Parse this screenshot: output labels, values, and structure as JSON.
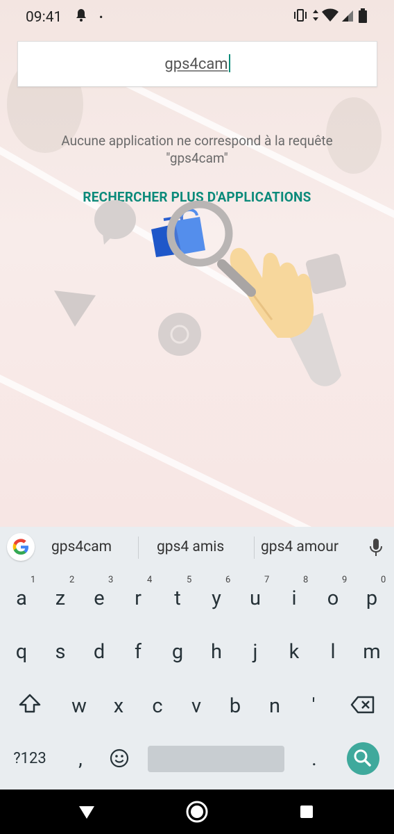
{
  "status_bar": {
    "time": "09:41",
    "icons": [
      "notification-bell-icon",
      "dot-icon",
      "vibrate-icon",
      "data-arrows-icon",
      "wifi-icon",
      "signal-icon",
      "battery-icon"
    ]
  },
  "search": {
    "query": "gps4cam"
  },
  "results": {
    "no_result_line1": "Aucune application ne correspond à la requête",
    "no_result_line2": "\"gps4cam\"",
    "more_apps_label": "RECHERCHER PLUS D'APPLICATIONS"
  },
  "suggestions": {
    "items": [
      "gps4cam",
      "gps4 amis",
      "gps4 amour"
    ]
  },
  "keyboard": {
    "row1": [
      {
        "key": "a",
        "hint": "1"
      },
      {
        "key": "z",
        "hint": "2"
      },
      {
        "key": "e",
        "hint": "3"
      },
      {
        "key": "r",
        "hint": "4"
      },
      {
        "key": "t",
        "hint": "5"
      },
      {
        "key": "y",
        "hint": "6"
      },
      {
        "key": "u",
        "hint": "7"
      },
      {
        "key": "i",
        "hint": "8"
      },
      {
        "key": "o",
        "hint": "9"
      },
      {
        "key": "p",
        "hint": "0"
      }
    ],
    "row2": [
      "q",
      "s",
      "d",
      "f",
      "g",
      "h",
      "j",
      "k",
      "l",
      "m"
    ],
    "row3": [
      "w",
      "x",
      "c",
      "v",
      "b",
      "n",
      "'"
    ],
    "symbols_label": "?123",
    "comma_label": ",",
    "period_label": "."
  },
  "colors": {
    "accent": "#0b8a7a",
    "search_key": "#3fa99c",
    "keyboard_bg": "#e9edf0"
  }
}
